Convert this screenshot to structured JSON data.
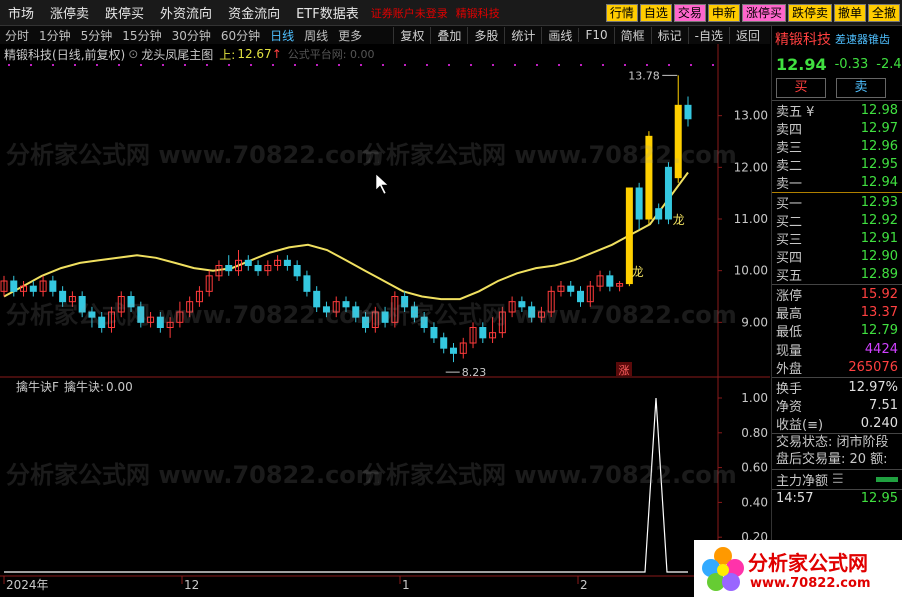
{
  "menu": [
    "市场",
    "涨停卖",
    "跌停买",
    "外资流向",
    "资金流向",
    "ETF数据表"
  ],
  "status": {
    "warning": "证券账户未登录",
    "stock": "精锻科技"
  },
  "quick_buttons": [
    {
      "label": "行情",
      "bg": "#ffcc00",
      "fg": "#000000"
    },
    {
      "label": "自选",
      "bg": "#ffcc00",
      "fg": "#000000"
    },
    {
      "label": "交易",
      "bg": "#ff66cc",
      "fg": "#000000"
    },
    {
      "label": "申新",
      "bg": "#ffcc00",
      "fg": "#000000"
    },
    {
      "label": "涨停买",
      "bg": "#ff66cc",
      "fg": "#000000"
    },
    {
      "label": "跌停卖",
      "bg": "#ffcc00",
      "fg": "#000000"
    },
    {
      "label": "撤单",
      "bg": "#ffcc00",
      "fg": "#000000"
    },
    {
      "label": "全撤",
      "bg": "#ffcc00",
      "fg": "#000000"
    }
  ],
  "periods": [
    "分时",
    "1分钟",
    "5分钟",
    "15分钟",
    "30分钟",
    "60分钟",
    "日线",
    "周线",
    "更多"
  ],
  "active_period": "日线",
  "tools": [
    "复权",
    "叠加",
    "多股",
    "统计",
    "画线",
    "F10",
    "简框",
    "标记",
    "-自选",
    "返回"
  ],
  "main_chart": {
    "stock_label": "精锻科技",
    "mode": "(日线,前复权)",
    "indicator": "龙头凤尾主图",
    "up_label": "上:",
    "up_value": "12.67",
    "extra": "公式平台网: 0.00",
    "high_mark": "13.78",
    "low_mark": "8.23",
    "dragon_label": "龙",
    "zhang_label": "涨",
    "price_axis": [
      "13.00",
      "12.00",
      "11.00",
      "10.00",
      "9.00"
    ]
  },
  "sub_chart": {
    "title": "擒牛诀F",
    "value_label": "擒牛诀:",
    "value": "0.00",
    "axis": [
      "1.00",
      "0.80",
      "0.60",
      "0.40",
      "0.20"
    ]
  },
  "date_axis": [
    "2024年",
    "12",
    "1",
    "2"
  ],
  "side": {
    "name": "精锻科技",
    "tag": "差速器锥齿",
    "price": "12.94",
    "change": "-0.33",
    "change_pct": "-2.4",
    "buy_label": "买",
    "sell_label": "卖",
    "asks": [
      {
        "label": "卖五 ¥",
        "price": "12.98",
        "color": "#40e040"
      },
      {
        "label": "卖四",
        "price": "12.97",
        "color": "#40e040"
      },
      {
        "label": "卖三",
        "price": "12.96",
        "color": "#40e040"
      },
      {
        "label": "卖二",
        "price": "12.95",
        "color": "#40e040"
      },
      {
        "label": "卖一",
        "price": "12.94",
        "color": "#40e040"
      }
    ],
    "bids": [
      {
        "label": "买一",
        "price": "12.93",
        "color": "#40e040"
      },
      {
        "label": "买二",
        "price": "12.92",
        "color": "#40e040"
      },
      {
        "label": "买三",
        "price": "12.91",
        "color": "#40e040"
      },
      {
        "label": "买四",
        "price": "12.90",
        "color": "#40e040"
      },
      {
        "label": "买五",
        "price": "12.89",
        "color": "#40e040"
      }
    ],
    "stats": [
      {
        "label": "涨停",
        "value": "15.92",
        "color": "#ff4040"
      },
      {
        "label": "最高",
        "value": "13.37",
        "color": "#ff4040"
      },
      {
        "label": "最低",
        "value": "12.79",
        "color": "#40e040"
      },
      {
        "label": "现量",
        "value": "4424",
        "color": "#d040ff"
      },
      {
        "label": "外盘",
        "value": "265076",
        "color": "#ff4040"
      }
    ],
    "stats2": [
      {
        "label": "换手",
        "value": "12.97%",
        "color": "#e0e0e0"
      },
      {
        "label": "净资",
        "value": "7.51",
        "color": "#e0e0e0"
      },
      {
        "label": "收益(≡)",
        "value": "0.240",
        "color": "#e0e0e0"
      }
    ],
    "trade_state": "交易状态: 闭市阶段",
    "after_hours": "盘后交易量: 20 额:",
    "fund_label": "主力净额",
    "tick_time": "14:57",
    "tick_price": "12.95"
  },
  "logo": {
    "text": "分析家公式网",
    "url": "www.70822.com"
  },
  "watermark": "分析家公式网 www.70822.com",
  "chart_data": {
    "type": "candlestick",
    "title": "龙头凤尾主图",
    "ylim": [
      8.0,
      14.0
    ],
    "candles": [
      {
        "o": 9.6,
        "c": 9.8,
        "h": 9.9,
        "l": 9.5
      },
      {
        "o": 9.8,
        "c": 9.6,
        "h": 9.9,
        "l": 9.5
      },
      {
        "o": 9.6,
        "c": 9.7,
        "h": 9.8,
        "l": 9.5
      },
      {
        "o": 9.7,
        "c": 9.6,
        "h": 9.8,
        "l": 9.5
      },
      {
        "o": 9.6,
        "c": 9.8,
        "h": 9.9,
        "l": 9.5
      },
      {
        "o": 9.8,
        "c": 9.6,
        "h": 9.9,
        "l": 9.5
      },
      {
        "o": 9.6,
        "c": 9.4,
        "h": 9.7,
        "l": 9.3
      },
      {
        "o": 9.4,
        "c": 9.5,
        "h": 9.6,
        "l": 9.3
      },
      {
        "o": 9.5,
        "c": 9.2,
        "h": 9.6,
        "l": 9.1
      },
      {
        "o": 9.2,
        "c": 9.1,
        "h": 9.3,
        "l": 8.9
      },
      {
        "o": 9.1,
        "c": 8.9,
        "h": 9.2,
        "l": 8.8
      },
      {
        "o": 8.9,
        "c": 9.2,
        "h": 9.3,
        "l": 8.8
      },
      {
        "o": 9.2,
        "c": 9.5,
        "h": 9.6,
        "l": 9.1
      },
      {
        "o": 9.5,
        "c": 9.3,
        "h": 9.6,
        "l": 9.2
      },
      {
        "o": 9.3,
        "c": 9.0,
        "h": 9.4,
        "l": 8.9
      },
      {
        "o": 9.0,
        "c": 9.1,
        "h": 9.2,
        "l": 8.9
      },
      {
        "o": 9.1,
        "c": 8.9,
        "h": 9.2,
        "l": 8.8
      },
      {
        "o": 8.9,
        "c": 9.0,
        "h": 9.1,
        "l": 8.7
      },
      {
        "o": 9.0,
        "c": 9.2,
        "h": 9.4,
        "l": 8.9
      },
      {
        "o": 9.2,
        "c": 9.4,
        "h": 9.5,
        "l": 9.1
      },
      {
        "o": 9.4,
        "c": 9.6,
        "h": 9.7,
        "l": 9.3
      },
      {
        "o": 9.6,
        "c": 9.9,
        "h": 10.0,
        "l": 9.5
      },
      {
        "o": 9.9,
        "c": 10.1,
        "h": 10.2,
        "l": 9.8
      },
      {
        "o": 10.1,
        "c": 10.0,
        "h": 10.3,
        "l": 9.9
      },
      {
        "o": 10.0,
        "c": 10.2,
        "h": 10.4,
        "l": 9.9
      },
      {
        "o": 10.2,
        "c": 10.1,
        "h": 10.3,
        "l": 10.0
      },
      {
        "o": 10.1,
        "c": 10.0,
        "h": 10.2,
        "l": 9.9
      },
      {
        "o": 10.0,
        "c": 10.1,
        "h": 10.2,
        "l": 9.9
      },
      {
        "o": 10.1,
        "c": 10.2,
        "h": 10.3,
        "l": 10.0
      },
      {
        "o": 10.2,
        "c": 10.1,
        "h": 10.3,
        "l": 10.0
      },
      {
        "o": 10.1,
        "c": 9.9,
        "h": 10.2,
        "l": 9.8
      },
      {
        "o": 9.9,
        "c": 9.6,
        "h": 10.0,
        "l": 9.5
      },
      {
        "o": 9.6,
        "c": 9.3,
        "h": 9.7,
        "l": 9.2
      },
      {
        "o": 9.3,
        "c": 9.2,
        "h": 9.4,
        "l": 9.1
      },
      {
        "o": 9.2,
        "c": 9.4,
        "h": 9.5,
        "l": 9.1
      },
      {
        "o": 9.4,
        "c": 9.3,
        "h": 9.5,
        "l": 9.2
      },
      {
        "o": 9.3,
        "c": 9.1,
        "h": 9.4,
        "l": 9.0
      },
      {
        "o": 9.1,
        "c": 8.9,
        "h": 9.2,
        "l": 8.8
      },
      {
        "o": 8.9,
        "c": 9.2,
        "h": 9.3,
        "l": 8.8
      },
      {
        "o": 9.2,
        "c": 9.0,
        "h": 9.3,
        "l": 8.9
      },
      {
        "o": 9.0,
        "c": 9.5,
        "h": 9.6,
        "l": 8.9
      },
      {
        "o": 9.5,
        "c": 9.3,
        "h": 9.6,
        "l": 9.2
      },
      {
        "o": 9.3,
        "c": 9.1,
        "h": 9.4,
        "l": 9.0
      },
      {
        "o": 9.1,
        "c": 8.9,
        "h": 9.2,
        "l": 8.8
      },
      {
        "o": 8.9,
        "c": 8.7,
        "h": 9.0,
        "l": 8.6
      },
      {
        "o": 8.7,
        "c": 8.5,
        "h": 8.8,
        "l": 8.4
      },
      {
        "o": 8.5,
        "c": 8.4,
        "h": 8.6,
        "l": 8.23
      },
      {
        "o": 8.4,
        "c": 8.6,
        "h": 8.7,
        "l": 8.3
      },
      {
        "o": 8.6,
        "c": 8.9,
        "h": 9.0,
        "l": 8.5
      },
      {
        "o": 8.9,
        "c": 8.7,
        "h": 9.0,
        "l": 8.6
      },
      {
        "o": 8.7,
        "c": 8.8,
        "h": 9.1,
        "l": 8.6
      },
      {
        "o": 8.8,
        "c": 9.2,
        "h": 9.3,
        "l": 8.7
      },
      {
        "o": 9.2,
        "c": 9.4,
        "h": 9.5,
        "l": 9.1
      },
      {
        "o": 9.4,
        "c": 9.3,
        "h": 9.5,
        "l": 9.2
      },
      {
        "o": 9.3,
        "c": 9.1,
        "h": 9.4,
        "l": 9.0
      },
      {
        "o": 9.1,
        "c": 9.2,
        "h": 9.3,
        "l": 9.0
      },
      {
        "o": 9.2,
        "c": 9.6,
        "h": 9.7,
        "l": 9.1
      },
      {
        "o": 9.6,
        "c": 9.7,
        "h": 9.8,
        "l": 9.5
      },
      {
        "o": 9.7,
        "c": 9.6,
        "h": 9.8,
        "l": 9.5
      },
      {
        "o": 9.6,
        "c": 9.4,
        "h": 9.7,
        "l": 9.3
      },
      {
        "o": 9.4,
        "c": 9.7,
        "h": 9.8,
        "l": 9.3
      },
      {
        "o": 9.7,
        "c": 9.9,
        "h": 10.0,
        "l": 9.6
      },
      {
        "o": 9.9,
        "c": 9.7,
        "h": 10.0,
        "l": 9.6
      },
      {
        "o": 9.7,
        "c": 9.75,
        "h": 9.8,
        "l": 9.6
      },
      {
        "o": 9.75,
        "c": 11.6,
        "h": 11.6,
        "l": 9.7
      },
      {
        "o": 11.6,
        "c": 11.0,
        "h": 11.7,
        "l": 10.8
      },
      {
        "o": 11.0,
        "c": 12.6,
        "h": 12.7,
        "l": 10.9
      },
      {
        "o": 11.2,
        "c": 11.0,
        "h": 11.3,
        "l": 10.9
      },
      {
        "o": 11.0,
        "c": 12.0,
        "h": 12.1,
        "l": 10.9
      },
      {
        "o": 11.8,
        "c": 13.2,
        "h": 13.78,
        "l": 11.7
      },
      {
        "o": 13.2,
        "c": 12.94,
        "h": 13.37,
        "l": 12.79
      }
    ],
    "ma": [
      10.3,
      10.5,
      10.7,
      10.85,
      10.95,
      11.0,
      11.05,
      11.1,
      11.05,
      10.95,
      10.85,
      10.8,
      10.85,
      11.0,
      11.15,
      11.25,
      11.3,
      11.2,
      11.0,
      10.8,
      10.6,
      10.4,
      10.3,
      10.25,
      10.25,
      10.4,
      10.6,
      10.75,
      10.85,
      10.9,
      11.0,
      11.15,
      11.3,
      11.5,
      11.7,
      12.2,
      12.7
    ],
    "sub_signal": {
      "ylim": [
        0,
        1
      ],
      "peak": 1.0
    }
  }
}
